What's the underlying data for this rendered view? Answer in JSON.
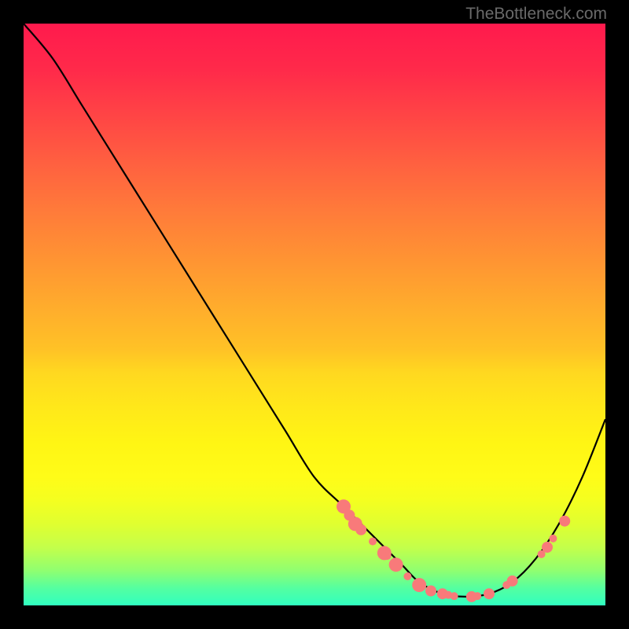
{
  "watermark": "TheBottleneck.com",
  "chart_data": {
    "type": "line",
    "title": "",
    "xlabel": "",
    "ylabel": "",
    "xlim": [
      0,
      100
    ],
    "ylim": [
      0,
      100
    ],
    "series": [
      {
        "name": "bottleneck-curve",
        "x": [
          0,
          5,
          10,
          15,
          20,
          25,
          30,
          35,
          40,
          45,
          50,
          55,
          60,
          65,
          68,
          72,
          76,
          80,
          84,
          88,
          92,
          96,
          100
        ],
        "y": [
          100,
          94,
          86,
          78,
          70,
          62,
          54,
          46,
          38,
          30,
          22,
          17,
          12,
          7,
          4,
          2,
          1.5,
          2,
          4,
          8,
          14,
          22,
          32
        ]
      }
    ],
    "highlighted_points": {
      "name": "data-markers",
      "color": "#f87a7a",
      "points": [
        {
          "x": 55,
          "y": 17,
          "size": "lg"
        },
        {
          "x": 56,
          "y": 15.5,
          "size": "md"
        },
        {
          "x": 57,
          "y": 14,
          "size": "lg"
        },
        {
          "x": 58,
          "y": 13,
          "size": "md"
        },
        {
          "x": 60,
          "y": 11,
          "size": "sm"
        },
        {
          "x": 62,
          "y": 9,
          "size": "lg"
        },
        {
          "x": 62.5,
          "y": 8.5,
          "size": "sm"
        },
        {
          "x": 64,
          "y": 7,
          "size": "lg"
        },
        {
          "x": 66,
          "y": 5,
          "size": "sm"
        },
        {
          "x": 68,
          "y": 3.5,
          "size": "lg"
        },
        {
          "x": 70,
          "y": 2.5,
          "size": "md"
        },
        {
          "x": 72,
          "y": 2,
          "size": "md"
        },
        {
          "x": 73,
          "y": 1.8,
          "size": "sm"
        },
        {
          "x": 74,
          "y": 1.6,
          "size": "sm"
        },
        {
          "x": 77,
          "y": 1.5,
          "size": "md"
        },
        {
          "x": 78,
          "y": 1.6,
          "size": "sm"
        },
        {
          "x": 80,
          "y": 2,
          "size": "md"
        },
        {
          "x": 83,
          "y": 3.5,
          "size": "sm"
        },
        {
          "x": 84,
          "y": 4.2,
          "size": "md"
        },
        {
          "x": 89,
          "y": 8.8,
          "size": "sm"
        },
        {
          "x": 90,
          "y": 10,
          "size": "md"
        },
        {
          "x": 91,
          "y": 11.5,
          "size": "sm"
        },
        {
          "x": 93,
          "y": 14.5,
          "size": "md"
        }
      ]
    }
  }
}
